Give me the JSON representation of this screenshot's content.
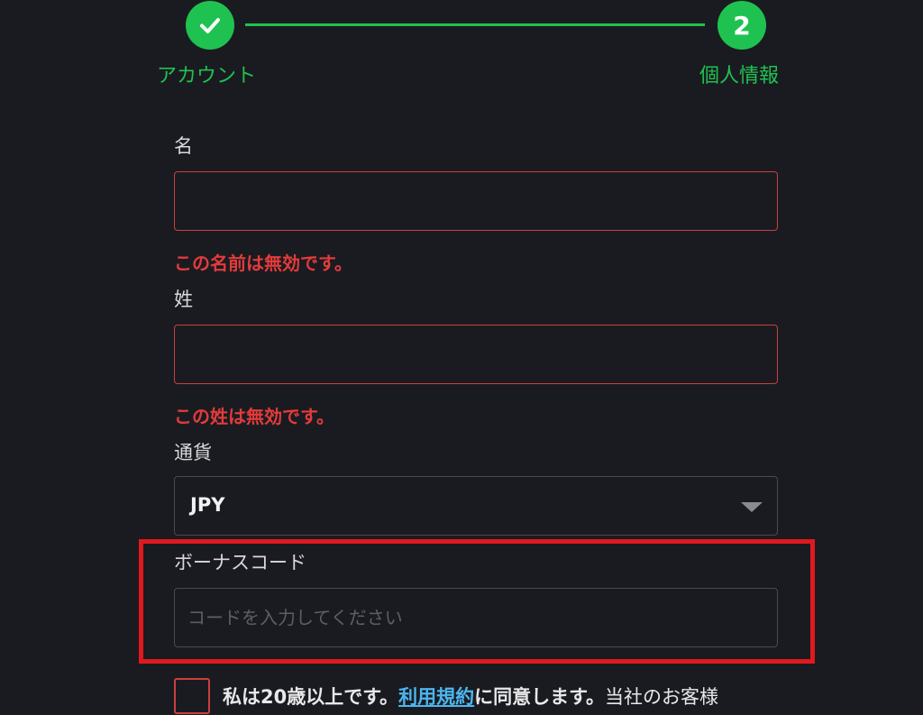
{
  "stepper": {
    "steps": [
      {
        "label": "アカウント",
        "state": "completed",
        "icon": "check-icon"
      },
      {
        "label": "個人情報",
        "number": "2",
        "state": "active"
      }
    ],
    "accent_color": "#1fc250"
  },
  "form": {
    "first_name": {
      "label": "名",
      "value": "",
      "error": "この名前は無効です。"
    },
    "last_name": {
      "label": "姓",
      "value": "",
      "error": "この姓は無効です。"
    },
    "currency": {
      "label": "通貨",
      "selected": "JPY",
      "icon": "chevron-down-icon"
    },
    "bonus_code": {
      "label": "ボーナスコード",
      "placeholder": "コードを入力してください",
      "value": ""
    },
    "age_consent": {
      "checked": false,
      "text_before": "私は20歳以上です。",
      "terms_link": "利用規約",
      "text_after": "に同意します。",
      "text_tail": "当社のお客様"
    }
  },
  "colors": {
    "error": "#e33b3b",
    "link": "#4cb6ef",
    "highlight": "#e0191f",
    "background": "#1a1b20"
  }
}
